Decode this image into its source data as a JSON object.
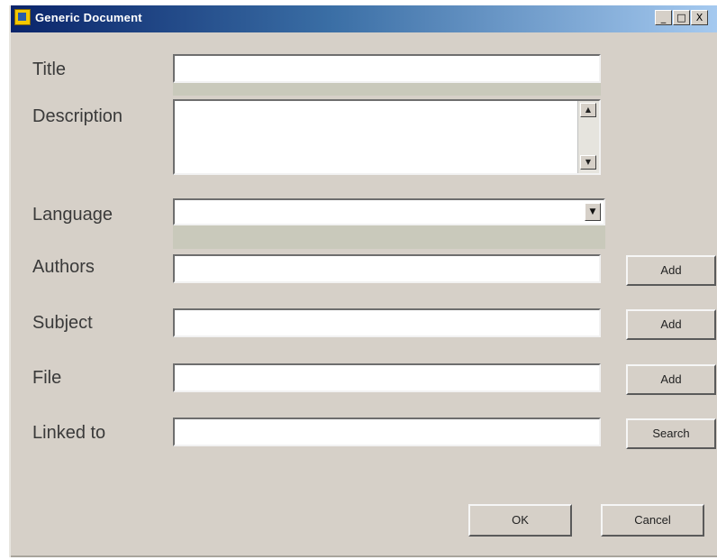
{
  "window": {
    "title": "Generic Document",
    "minimize_glyph": "_",
    "maximize_glyph": "□",
    "close_glyph": "X"
  },
  "form": {
    "title_label": "Title",
    "description_label": "Description",
    "language_label": "Language",
    "authors_label": "Authors",
    "subject_label": "Subject",
    "file_label": "File",
    "linked_to_label": "Linked to",
    "title_value": "",
    "description_value": "",
    "language_value": "",
    "authors_value": "",
    "subject_value": "",
    "file_value": "",
    "linked_to_value": ""
  },
  "buttons": {
    "authors_add": "Add",
    "subject_add": "Add",
    "file_add": "Add",
    "linked_search": "Search",
    "ok": "OK",
    "cancel": "Cancel"
  },
  "icons": {
    "scroll_up": "▲",
    "scroll_down": "▼",
    "combo_arrow": "▼"
  },
  "colors": {
    "titlebar_start": "#0a246a",
    "titlebar_end": "#a6caf0",
    "dialog_background": "#d6d0c8"
  }
}
